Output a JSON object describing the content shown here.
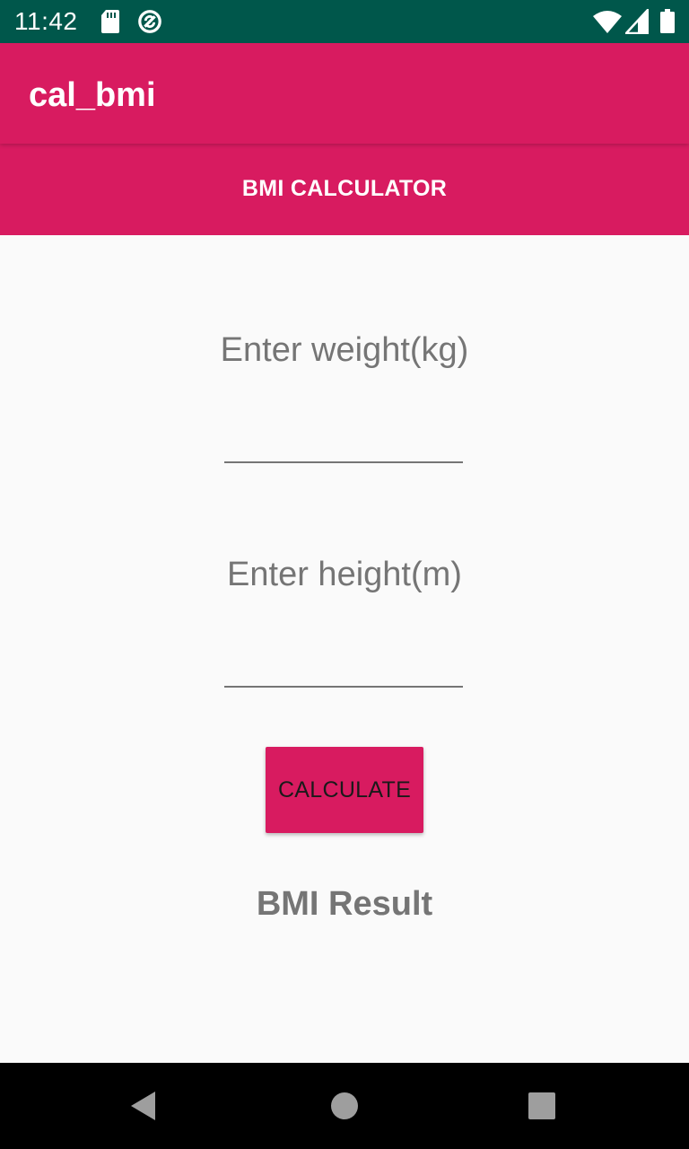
{
  "status_bar": {
    "time": "11:42",
    "icons": [
      "sd-card-icon",
      "sync-icon",
      "wifi-icon",
      "signal-icon",
      "battery-icon"
    ],
    "background": "#00574b"
  },
  "app_bar": {
    "title": "cal_bmi",
    "color": "#d81b60"
  },
  "banner": {
    "text": "BMI CALCULATOR"
  },
  "form": {
    "weight_label": "Enter weight(kg)",
    "weight_value": "",
    "height_label": "Enter height(m)",
    "height_value": "",
    "calculate_label": "CALCULATE"
  },
  "result": {
    "text": "BMI Result"
  },
  "nav_bar": {
    "icons": [
      "back-icon",
      "home-icon",
      "recents-icon"
    ]
  }
}
